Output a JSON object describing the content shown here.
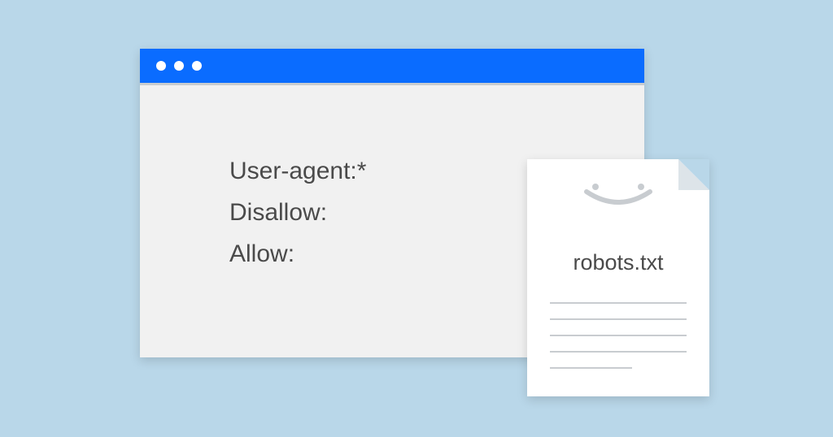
{
  "code": {
    "line1": "User-agent:*",
    "line2": "Disallow:",
    "line3": "Allow:"
  },
  "file": {
    "name": "robots.txt"
  }
}
